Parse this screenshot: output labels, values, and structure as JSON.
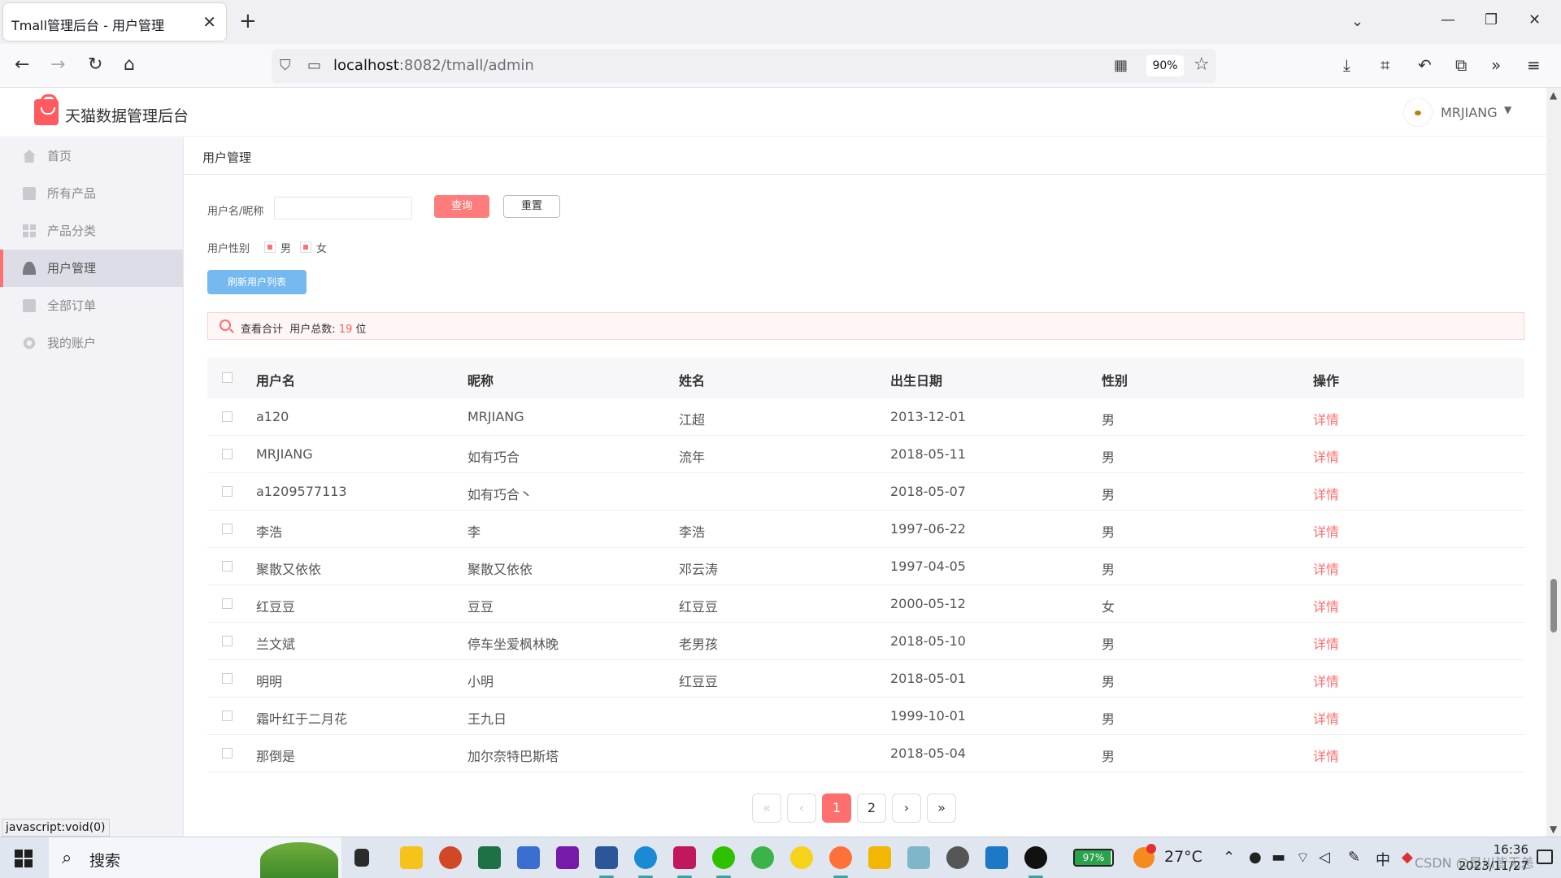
{
  "browser": {
    "tab_title": "Tmall管理后台 - 用户管理",
    "url_host": "localhost",
    "url_path": ":8082/tmall/admin",
    "zoom": "90%",
    "status_text": "javascript:void(0)"
  },
  "app": {
    "title": "天猫数据管理后台",
    "user": "MRJIANG"
  },
  "sidebar": {
    "items": [
      {
        "label": "首页"
      },
      {
        "label": "所有产品"
      },
      {
        "label": "产品分类"
      },
      {
        "label": "用户管理"
      },
      {
        "label": "全部订单"
      },
      {
        "label": "我的账户"
      }
    ]
  },
  "breadcrumb": "用户管理",
  "filters": {
    "name_label": "用户名/昵称",
    "name_value": "",
    "query_label": "查询",
    "reset_label": "重置",
    "gender_label": "用户性别",
    "gender_male": "男",
    "gender_female": "女",
    "refresh_label": "刷新用户列表"
  },
  "summary": {
    "prefix": "查看合计",
    "total_label": "用户总数:",
    "total_count": "19",
    "unit": "位"
  },
  "table": {
    "headers": [
      "用户名",
      "昵称",
      "姓名",
      "出生日期",
      "性别",
      "操作"
    ],
    "rows": [
      [
        "a120",
        "MRJIANG",
        "江超",
        "2013-12-01",
        "男",
        "详情"
      ],
      [
        "MRJIANG",
        "如有巧合",
        "流年",
        "2018-05-11",
        "男",
        "详情"
      ],
      [
        "a1209577113",
        "如有巧合丶",
        "",
        "2018-05-07",
        "男",
        "详情"
      ],
      [
        "李浩",
        "李",
        "李浩",
        "1997-06-22",
        "男",
        "详情"
      ],
      [
        "聚散又依依",
        "聚散又依依",
        "邓云涛",
        "1997-04-05",
        "男",
        "详情"
      ],
      [
        "红豆豆",
        "豆豆",
        "红豆豆",
        "2000-05-12",
        "女",
        "详情"
      ],
      [
        "兰文斌",
        "停车坐爱枫林晚",
        "老男孩",
        "2018-05-10",
        "男",
        "详情"
      ],
      [
        "明明",
        "小明",
        "红豆豆",
        "2018-05-01",
        "男",
        "详情"
      ],
      [
        "霜叶红于二月花",
        "王九日",
        "",
        "1999-10-01",
        "男",
        "详情"
      ],
      [
        "那倒是",
        "加尔奈特巴斯塔",
        "",
        "2018-05-04",
        "男",
        "详情"
      ]
    ]
  },
  "pager": {
    "first": "«",
    "prev": "‹",
    "pages": [
      "1",
      "2"
    ],
    "next": "›",
    "last": "»"
  },
  "taskbar": {
    "search": "搜索",
    "battery": "97%",
    "temperature": "27°C",
    "time": "16:36",
    "date": "2023/11/27",
    "watermark": "CSDN @是川皆无恙"
  }
}
